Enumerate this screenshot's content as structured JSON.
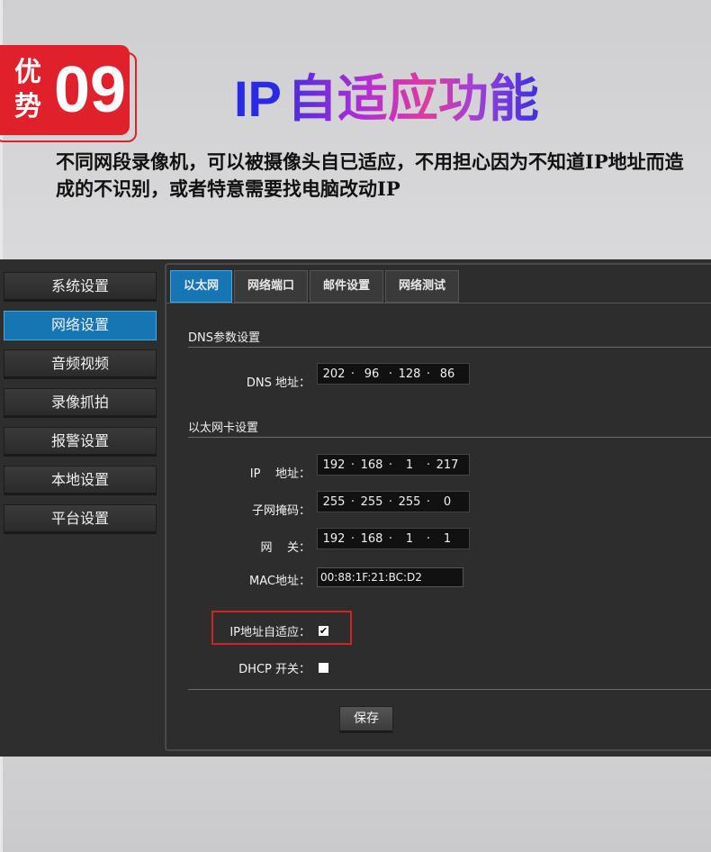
{
  "badge": {
    "chars": [
      "优",
      "势"
    ],
    "number": "09"
  },
  "headline": {
    "ip": "IP",
    "text": "自适应功能"
  },
  "description": "不同网段录像机，可以被摄像头自已适应，不用担心因为不知道IP地址而造成的不识别，或者特意需要找电脑改动IP",
  "sidebar": {
    "items": [
      {
        "label": "系统设置",
        "active": false
      },
      {
        "label": "网络设置",
        "active": true
      },
      {
        "label": "音频视频",
        "active": false
      },
      {
        "label": "录像抓拍",
        "active": false
      },
      {
        "label": "报警设置",
        "active": false
      },
      {
        "label": "本地设置",
        "active": false
      },
      {
        "label": "平台设置",
        "active": false
      }
    ]
  },
  "tabs": [
    {
      "label": "以太网",
      "active": true
    },
    {
      "label": "网络端口",
      "active": false
    },
    {
      "label": "邮件设置",
      "active": false
    },
    {
      "label": "网络测试",
      "active": false
    }
  ],
  "dns": {
    "section_title": "DNS参数设置",
    "label": "DNS 地址：",
    "octets": [
      "202",
      "96",
      "128",
      "86"
    ]
  },
  "ethernet": {
    "section_title": "以太网卡设置",
    "ip": {
      "label": "IP    地址：",
      "octets": [
        "192",
        "168",
        "1",
        "217"
      ]
    },
    "subnet": {
      "label": "子网掩码：",
      "octets": [
        "255",
        "255",
        "255",
        "0"
      ]
    },
    "gateway": {
      "label": "网    关：",
      "octets": [
        "192",
        "168",
        "1",
        "1"
      ]
    },
    "mac": {
      "label": "MAC地址：",
      "value": "00:88:1F:21:BC:D2"
    }
  },
  "options": {
    "ip_adaptive": {
      "label": "IP地址自适应：",
      "checked": true
    },
    "dhcp": {
      "label": "DHCP 开关：",
      "checked": false
    }
  },
  "save_label": "保存",
  "colors": {
    "accent": "#1675b3",
    "badge_red": "#e0202a",
    "highlight_frame": "#d2232a"
  }
}
